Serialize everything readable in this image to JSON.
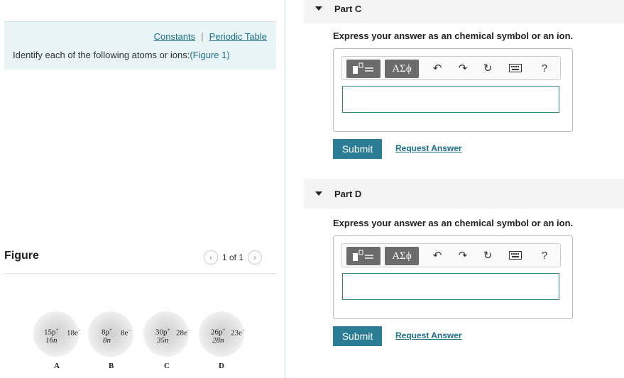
{
  "info": {
    "constants": "Constants",
    "separator": "|",
    "periodic_table": "Periodic Table",
    "identify_text": "Identify each of the following atoms or ions:",
    "figure_link": "(Figure 1)"
  },
  "figure": {
    "title": "Figure",
    "pager": "1 of 1",
    "atoms": [
      {
        "label": "A",
        "protons": "15p",
        "neutrons": "16n",
        "electrons": "18e"
      },
      {
        "label": "B",
        "protons": "8p",
        "neutrons": "8n",
        "electrons": "8e"
      },
      {
        "label": "C",
        "protons": "30p",
        "neutrons": "35n",
        "electrons": "28e"
      },
      {
        "label": "D",
        "protons": "26p",
        "neutrons": "28n",
        "electrons": "23e"
      }
    ]
  },
  "parts": [
    {
      "title": "Part C",
      "instruction": "Express your answer as an chemical symbol or an ion.",
      "greek": "ΑΣϕ",
      "help": "?",
      "submit": "Submit",
      "request": "Request Answer",
      "answer": ""
    },
    {
      "title": "Part D",
      "instruction": "Express your answer as an chemical symbol or an ion.",
      "greek": "ΑΣϕ",
      "help": "?",
      "submit": "Submit",
      "request": "Request Answer",
      "answer": ""
    }
  ],
  "colors": {
    "accent": "#2b7d95",
    "link": "#1b6f8a",
    "info_bg": "#e8f4f5"
  }
}
